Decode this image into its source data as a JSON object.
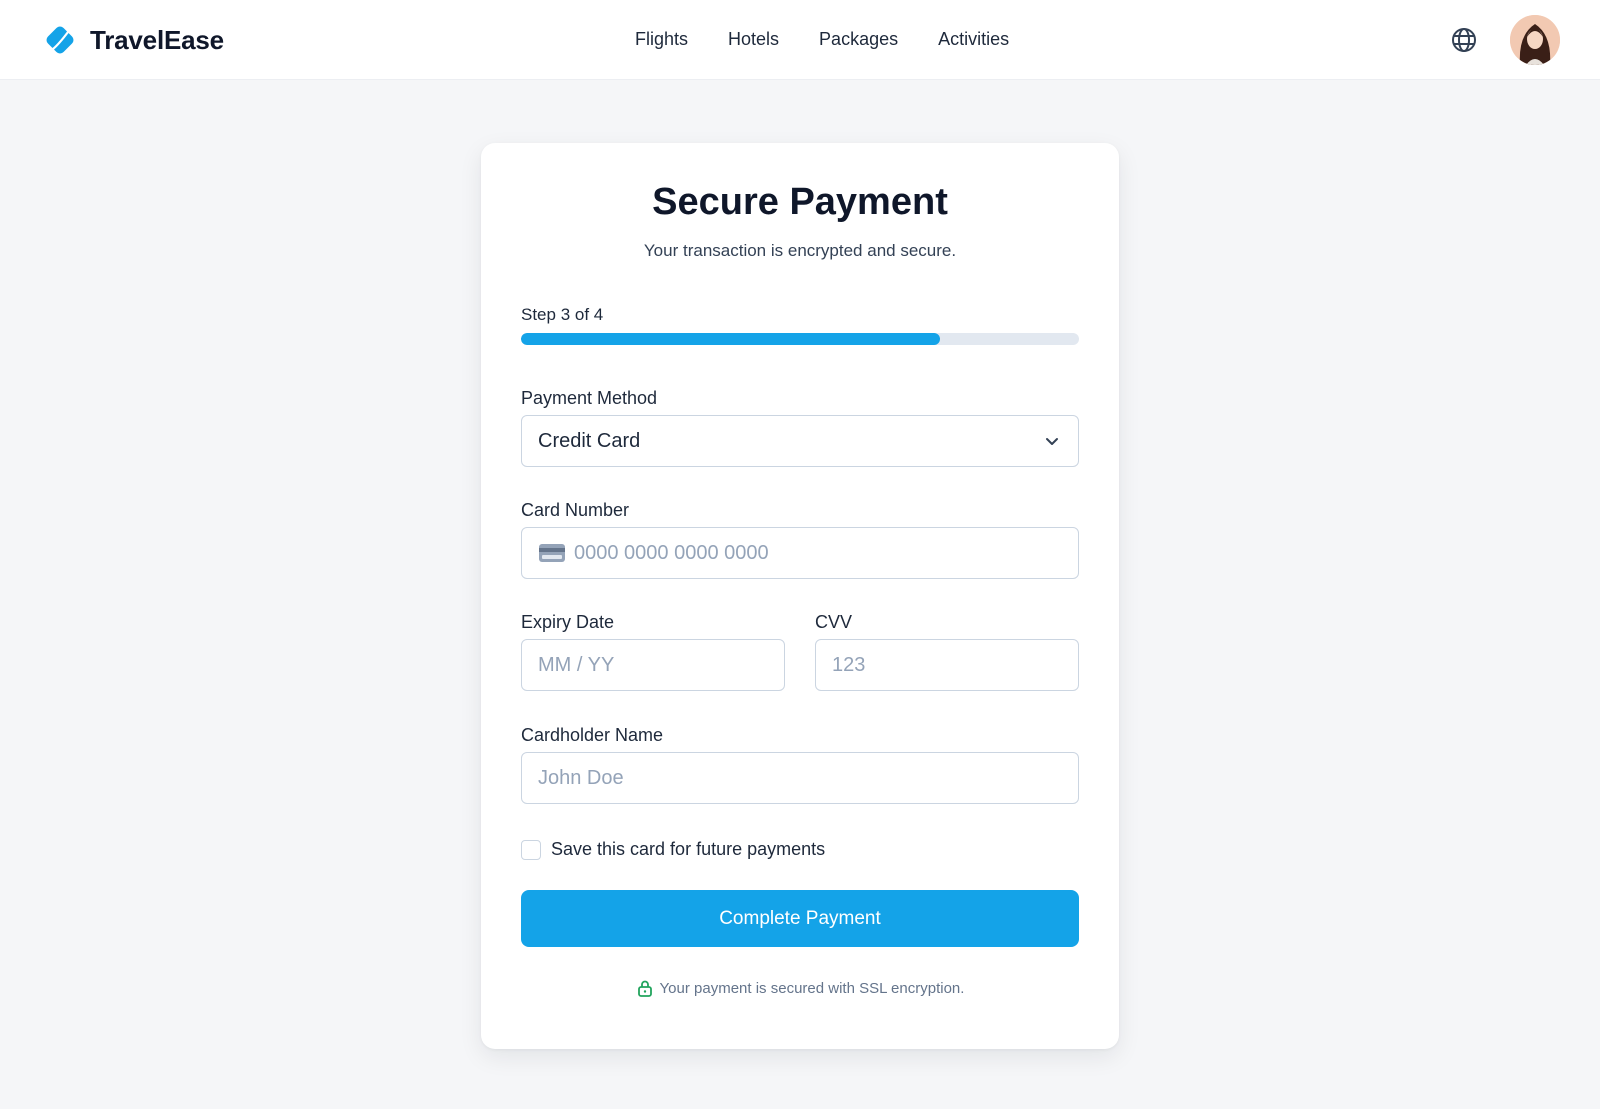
{
  "header": {
    "brand_name": "TravelEase",
    "nav": [
      "Flights",
      "Hotels",
      "Packages",
      "Activities"
    ],
    "icons": {
      "logo": "tag-logo-icon",
      "language": "globe-icon",
      "profile": "avatar"
    }
  },
  "payment": {
    "title": "Secure Payment",
    "subtitle": "Your transaction is encrypted and secure.",
    "step_label": "Step 3 of 4",
    "progress_fraction": 0.75,
    "method_label": "Payment Method",
    "method_value": "Credit Card",
    "card_number_label": "Card Number",
    "card_number_placeholder": "0000 0000 0000 0000",
    "expiry_label": "Expiry Date",
    "expiry_placeholder": "MM / YY",
    "cvv_label": "CVV",
    "cvv_placeholder": "123",
    "name_label": "Cardholder Name",
    "name_placeholder": "John Doe",
    "save_card_label": "Save this card for future payments",
    "submit_label": "Complete Payment",
    "secure_note": "Your payment is secured with SSL encryption."
  },
  "colors": {
    "accent": "#14a3e8",
    "secure_green": "#22a45d",
    "background": "#f5f6f8"
  }
}
